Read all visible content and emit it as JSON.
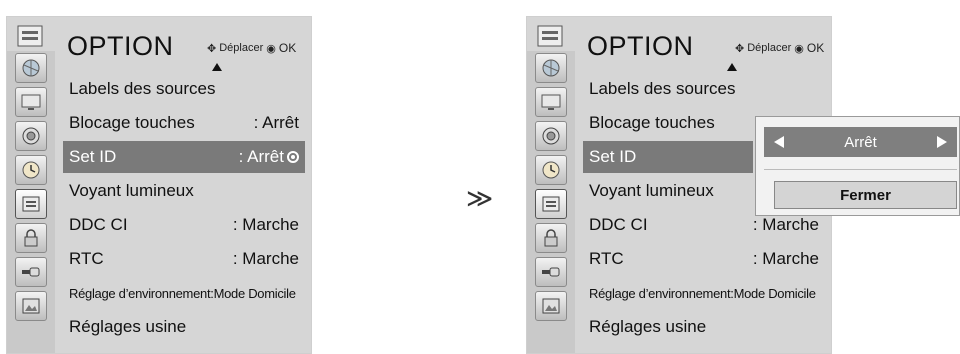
{
  "separator": "≫",
  "left": {
    "title": "OPTION",
    "hint_move": "Déplacer",
    "hint_ok": "OK",
    "items": [
      {
        "label": "Labels des sources",
        "value": ""
      },
      {
        "label": "Blocage touches",
        "value": ": Arrêt"
      },
      {
        "label": "Set ID",
        "value": ": Arrêt"
      },
      {
        "label": "Voyant lumineux",
        "value": ""
      },
      {
        "label": "DDC CI",
        "value": ": Marche"
      },
      {
        "label": "RTC",
        "value": ": Marche"
      },
      {
        "label": "Réglage d’environnement:Mode Domicile",
        "value": ""
      },
      {
        "label": "Réglages usine",
        "value": ""
      }
    ]
  },
  "right": {
    "title": "OPTION",
    "hint_move": "Déplacer",
    "hint_ok": "OK",
    "items": [
      {
        "label": "Labels des sources",
        "value": ""
      },
      {
        "label": "Blocage touches",
        "value": ""
      },
      {
        "label": "Set ID",
        "value": ""
      },
      {
        "label": "Voyant lumineux",
        "value": ""
      },
      {
        "label": "DDC CI",
        "value": ": Marche"
      },
      {
        "label": "RTC",
        "value": ": Marche"
      },
      {
        "label": "Réglage d’environnement:Mode Domicile",
        "value": ""
      },
      {
        "label": "Réglages usine",
        "value": ""
      }
    ]
  },
  "popup": {
    "value": "Arrêt",
    "close_label": "Fermer"
  },
  "sidebar_icons": [
    "picture-icon",
    "monitor-icon",
    "sound-icon",
    "clock-icon",
    "option-icon",
    "lock-icon",
    "input-icon",
    "photo-icon"
  ],
  "colors": {
    "panel_bg": "#d6d6d6",
    "selection": "#7a7a7a",
    "popup_bg": "#f2f2f2"
  }
}
